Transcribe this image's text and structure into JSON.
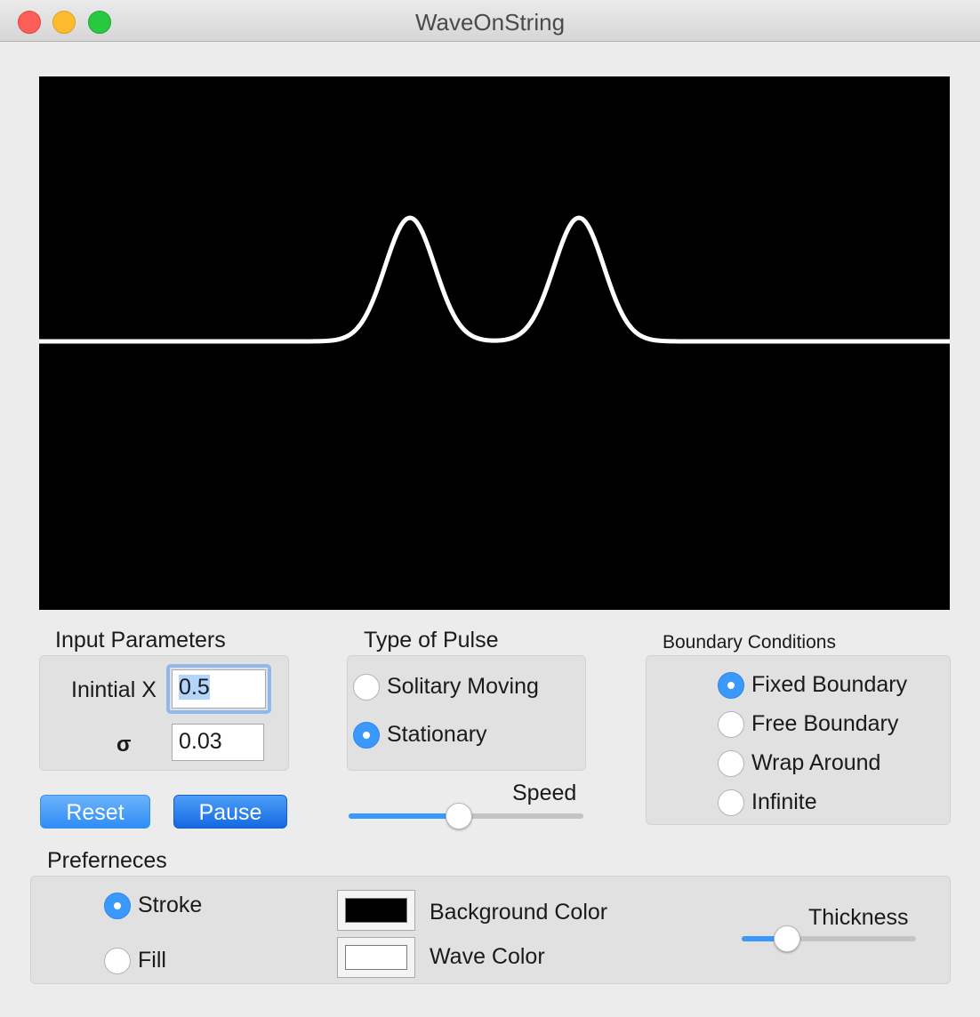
{
  "window": {
    "title": "WaveOnString"
  },
  "input_parameters": {
    "title": "Input Parameters",
    "initial_x_label": "Inintial X",
    "initial_x_value": "0.5",
    "sigma_label": "σ",
    "sigma_value": "0.03"
  },
  "buttons": {
    "reset": "Reset",
    "pause": "Pause"
  },
  "pulse_type": {
    "title": "Type of Pulse",
    "options": [
      {
        "label": "Solitary Moving",
        "selected": false
      },
      {
        "label": "Stationary",
        "selected": true
      }
    ]
  },
  "speed": {
    "label": "Speed",
    "value": 0.47
  },
  "boundary_conditions": {
    "title": "Boundary Conditions",
    "options": [
      {
        "label": "Fixed Boundary",
        "selected": true
      },
      {
        "label": "Free Boundary",
        "selected": false
      },
      {
        "label": "Wrap Around",
        "selected": false
      },
      {
        "label": "Infinite",
        "selected": false
      }
    ]
  },
  "preferences": {
    "title": "Preferneces",
    "draw_mode": [
      {
        "label": "Stroke",
        "selected": true
      },
      {
        "label": "Fill",
        "selected": false
      }
    ],
    "background_color_label": "Background Color",
    "background_color": "#000000",
    "wave_color_label": "Wave Color",
    "wave_color": "#ffffff",
    "thickness_label": "Thickness",
    "thickness": 0.26
  },
  "wave": {
    "stroke_color": "#ffffff",
    "background": "#000000"
  }
}
